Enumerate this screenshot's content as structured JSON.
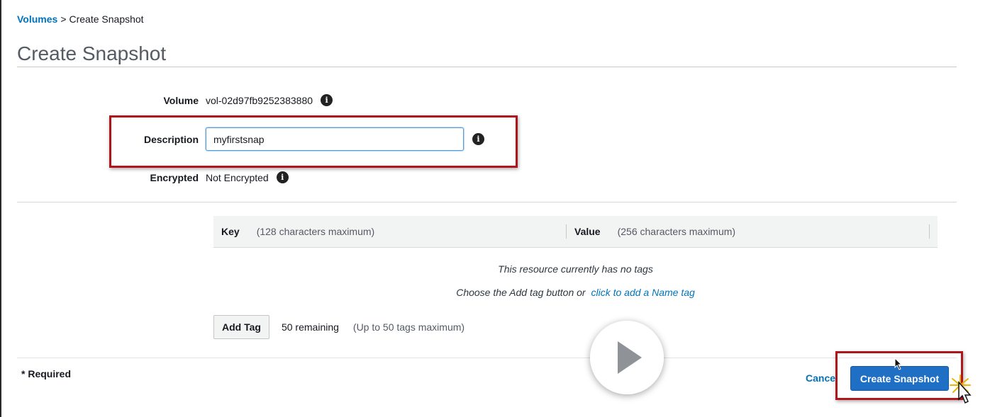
{
  "breadcrumb": {
    "parent": "Volumes",
    "separator": ">",
    "current": "Create Snapshot"
  },
  "page_title": "Create Snapshot",
  "form": {
    "volume": {
      "label": "Volume",
      "value": "vol-02d97fb9252383880"
    },
    "description": {
      "label": "Description",
      "value": "myfirstsnap"
    },
    "encrypted": {
      "label": "Encrypted",
      "value": "Not Encrypted"
    }
  },
  "tags": {
    "key_header": "Key",
    "key_hint": "(128 characters maximum)",
    "value_header": "Value",
    "value_hint": "(256 characters maximum)",
    "empty_message": "This resource currently has no tags",
    "hint_prefix": "Choose the Add tag button or",
    "hint_link": "click to add a Name tag",
    "add_button": "Add Tag",
    "remaining": "50 remaining",
    "max_note": "(Up to 50 tags maximum)"
  },
  "footer": {
    "required_note": "* Required",
    "cancel_label": "Cancel",
    "create_label": "Create Snapshot"
  },
  "colors": {
    "link": "#0073bb",
    "primary_button": "#1f6fc5",
    "highlight_border": "#b0151b"
  },
  "icons": [
    "info-icon",
    "play-icon",
    "mouse-pointer-icon",
    "click-burst-icon"
  ]
}
